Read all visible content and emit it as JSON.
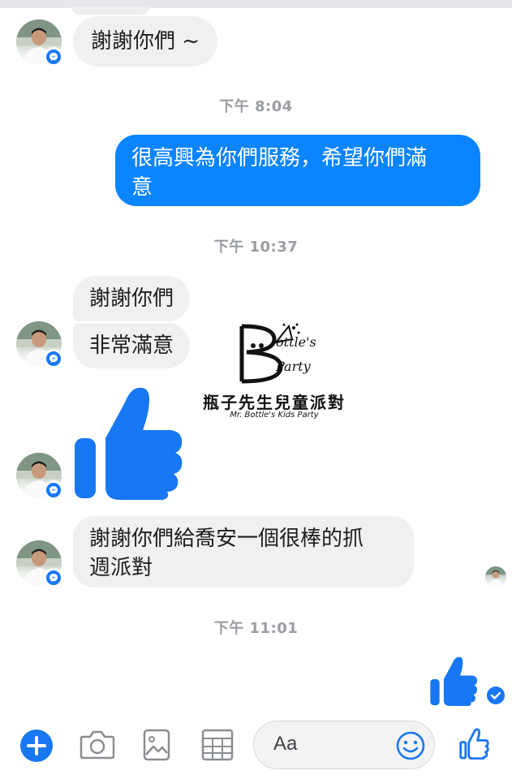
{
  "messages": [
    {
      "id": "m1",
      "direction": "in",
      "text": "謝謝你們 ~"
    },
    {
      "id": "m2",
      "direction": "out",
      "lines": [
        "很高興為你們服務，希望你們滿",
        "意"
      ]
    },
    {
      "id": "m3",
      "direction": "in",
      "text": "謝謝你們"
    },
    {
      "id": "m4",
      "direction": "in",
      "text": "非常滿意"
    },
    {
      "id": "m5",
      "direction": "in",
      "lines": [
        "謝謝你們給喬安一個很棒的抓",
        "週派對"
      ]
    }
  ],
  "timestamps": [
    "下午 8:04",
    "下午 10:37",
    "下午 11:01"
  ],
  "watermark": {
    "zh": "瓶子先生兒童派對",
    "en": "Mr. Bottle's Kids Party",
    "logo_b": "B",
    "logo_bottle": "ottle's",
    "logo_party": "Party"
  },
  "composer": {
    "placeholder": "Aa",
    "icons": [
      "plus-icon",
      "camera-icon",
      "gallery-icon",
      "sticker-grid-icon",
      "emoji-icon",
      "like-icon"
    ]
  },
  "colors": {
    "accent": "#0b84ff",
    "incoming_bubble": "#f0f0f0",
    "timestamp": "#9a9da2",
    "like_blue": "#1877f2"
  }
}
